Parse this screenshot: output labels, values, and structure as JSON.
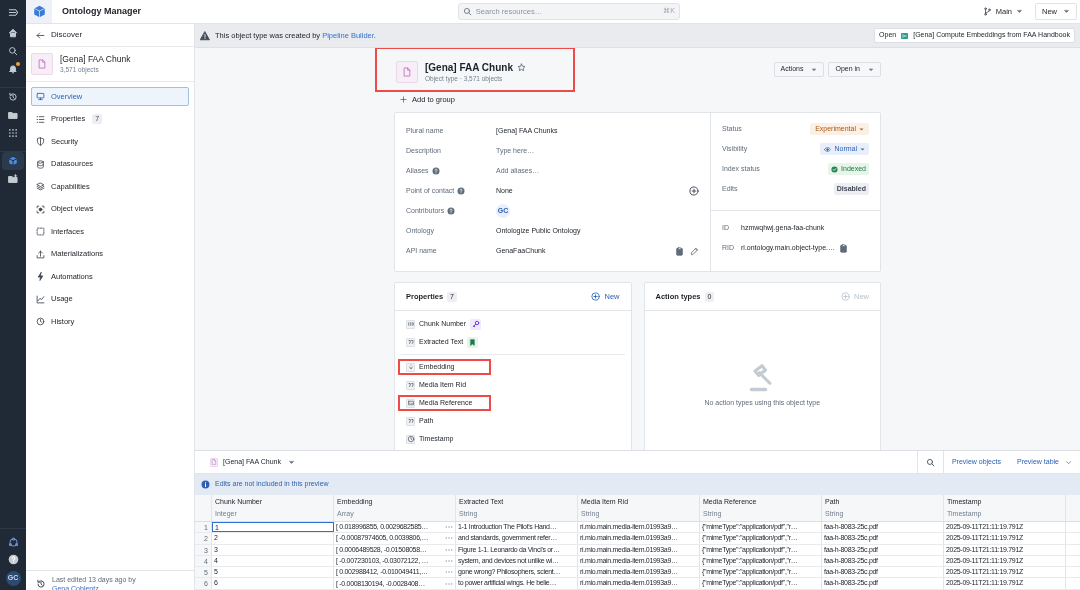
{
  "app": {
    "title": "Ontology Manager",
    "search_placeholder": "Search resources…",
    "shortcut": "⌘K",
    "branch": "Main",
    "new_button": "New"
  },
  "rail": {
    "items": [
      {
        "kind": "home",
        "selected": false
      },
      {
        "kind": "search",
        "selected": false
      },
      {
        "kind": "bell",
        "selected": false
      },
      {
        "kind": "history",
        "selected": false
      },
      {
        "kind": "folder",
        "selected": false
      },
      {
        "kind": "grid",
        "selected": false
      },
      {
        "kind": "cube",
        "selected": true
      },
      {
        "kind": "folder-plus",
        "selected": false
      }
    ],
    "avatar": "GC"
  },
  "sidebar": {
    "back": "Discover",
    "object": {
      "name": "[Gena] FAA Chunk",
      "count": "3,571 objects"
    },
    "items": [
      {
        "label": "Overview",
        "selected": true
      },
      {
        "label": "Properties",
        "badge": "7",
        "selected": false
      },
      {
        "label": "Security",
        "selected": false
      },
      {
        "label": "Datasources",
        "selected": false
      },
      {
        "label": "Capabilities",
        "selected": false
      },
      {
        "label": "Object views",
        "selected": false
      },
      {
        "label": "Interfaces",
        "selected": false
      },
      {
        "label": "Materializations",
        "selected": false
      },
      {
        "label": "Automations",
        "selected": false
      },
      {
        "label": "Usage",
        "selected": false
      },
      {
        "label": "History",
        "selected": false
      }
    ],
    "footer": {
      "text": "Last edited 13 days ago by",
      "author": "Gena Coblentz"
    }
  },
  "banner": {
    "text": "This object type was created by ",
    "link": "Pipeline Builder",
    "period": ".",
    "open_label": "Open",
    "open_target": "[Gena] Compute Embeddings from FAA Handbook"
  },
  "header": {
    "title": "[Gena] FAA Chunk",
    "subtitle": "Object type · 3,571 objects",
    "highlighted": true,
    "add_to_group": "Add to group",
    "buttons": [
      "Actions",
      "Open in"
    ]
  },
  "details": {
    "rows": [
      {
        "label": "Plural name",
        "help": false,
        "value": "[Gena] FAA Chunks",
        "kind": "text"
      },
      {
        "label": "Description",
        "help": false,
        "value": "Type here…",
        "kind": "placeholder"
      },
      {
        "label": "Aliases",
        "help": true,
        "value": "Add aliases…",
        "kind": "placeholder"
      },
      {
        "label": "Point of contact",
        "help": true,
        "value": "None",
        "kind": "contact"
      },
      {
        "label": "Contributors",
        "help": true,
        "value": "GC",
        "kind": "avatar"
      },
      {
        "label": "Ontology",
        "help": false,
        "value": "Ontologize Public Ontology",
        "kind": "text"
      },
      {
        "label": "API name",
        "help": false,
        "value": "GenaFaaChunk",
        "kind": "api"
      }
    ],
    "status": [
      {
        "label": "Status",
        "value": "Experimental",
        "kind": "warning"
      },
      {
        "label": "Visibility",
        "value": "Normal",
        "kind": "visibility"
      },
      {
        "label": "Index status",
        "value": "Indexed",
        "kind": "success"
      },
      {
        "label": "Edits",
        "value": "Disabled",
        "kind": "neutral"
      }
    ],
    "ids": [
      {
        "label": "ID",
        "value": "hzmwqhwj.gena-faa-chunk",
        "copyable": false
      },
      {
        "label": "RID",
        "value": "ri.ontology.main.object-type.…",
        "copyable": true
      }
    ]
  },
  "properties": {
    "title": "Properties",
    "count": "7",
    "new_label": "New",
    "groups": [
      [
        {
          "name": "Chunk Number",
          "kind": "number",
          "primary_key": true,
          "title_key": false,
          "highlighted": false
        },
        {
          "name": "Extracted Text",
          "kind": "string",
          "primary_key": false,
          "title_key": true,
          "highlighted": false
        }
      ],
      [
        {
          "name": "Embedding",
          "kind": "vector",
          "primary_key": false,
          "title_key": false,
          "highlighted": true
        },
        {
          "name": "Media Item Rid",
          "kind": "string",
          "primary_key": false,
          "title_key": false,
          "highlighted": false
        },
        {
          "name": "Media Reference",
          "kind": "media",
          "primary_key": false,
          "title_key": false,
          "highlighted": true
        },
        {
          "name": "Path",
          "kind": "string",
          "primary_key": false,
          "title_key": false,
          "highlighted": false
        },
        {
          "name": "Timestamp",
          "kind": "time",
          "primary_key": false,
          "title_key": false,
          "highlighted": false
        }
      ]
    ]
  },
  "action_types": {
    "title": "Action types",
    "count": "0",
    "new_label": "New",
    "empty": "No action types using this object type"
  },
  "preview": {
    "object": "[Gena] FAA Chunk",
    "buttons": [
      "Preview objects",
      "Preview table"
    ],
    "notice": "Edits are not included in this preview",
    "columns": [
      {
        "name": "Chunk Number",
        "type": "Integer"
      },
      {
        "name": "Embedding",
        "type": "Array"
      },
      {
        "name": "Extracted Text",
        "type": "String"
      },
      {
        "name": "Media Item Rid",
        "type": "String"
      },
      {
        "name": "Media Reference",
        "type": "String"
      },
      {
        "name": "Path",
        "type": "String"
      },
      {
        "name": "Timestamp",
        "type": "Timestamp"
      }
    ],
    "rows": [
      {
        "n": "1",
        "selected": true,
        "cells": [
          "1",
          "[ 0.018996855, 0.0029682585…",
          "1-1 Introduction The Pilot's Hand…",
          "ri.mio.main.media-item.01993a9…",
          "{\"mimeType\":\"application/pdf\",\"r…",
          "faa-h-8083-25c.pdf",
          "2025-09-11T21:11:19.791Z"
        ]
      },
      {
        "n": "2",
        "selected": false,
        "cells": [
          "2",
          "[ -0.00087974605, 0.0039806,…",
          "and standards, government refer…",
          "ri.mio.main.media-item.01993a9…",
          "{\"mimeType\":\"application/pdf\",\"r…",
          "faa-h-8083-25c.pdf",
          "2025-09-11T21:11:19.791Z"
        ]
      },
      {
        "n": "3",
        "selected": false,
        "cells": [
          "3",
          "[ 0.0006489528, -0.01508058…",
          "Figure 1-1. Leonardo da Vinci's or…",
          "ri.mio.main.media-item.01993a9…",
          "{\"mimeType\":\"application/pdf\",\"r…",
          "faa-h-8083-25c.pdf",
          "2025-09-11T21:11:19.791Z"
        ]
      },
      {
        "n": "4",
        "selected": false,
        "cells": [
          "4",
          "[ -0.007230103, -0.03072122, …",
          "system, and devices not unlike wi…",
          "ri.mio.main.media-item.01993a9…",
          "{\"mimeType\":\"application/pdf\",\"r…",
          "faa-h-8083-25c.pdf",
          "2025-09-11T21:11:19.791Z"
        ]
      },
      {
        "n": "5",
        "selected": false,
        "cells": [
          "5",
          "[ 0.002988412, -0.010049411,…",
          "gone wrong? Philosophers, scient…",
          "ri.mio.main.media-item.01993a9…",
          "{\"mimeType\":\"application/pdf\",\"r…",
          "faa-h-8083-25c.pdf",
          "2025-09-11T21:11:19.791Z"
        ]
      },
      {
        "n": "6",
        "selected": false,
        "cells": [
          "6",
          "[ -0.0008130194, -0.0028408…",
          "to power artificial wings. He belie…",
          "ri.mio.main.media-item.01993a9…",
          "{\"mimeType\":\"application/pdf\",\"r…",
          "faa-h-8083-25c.pdf",
          "2025-09-11T21:11:19.791Z"
        ]
      }
    ]
  }
}
